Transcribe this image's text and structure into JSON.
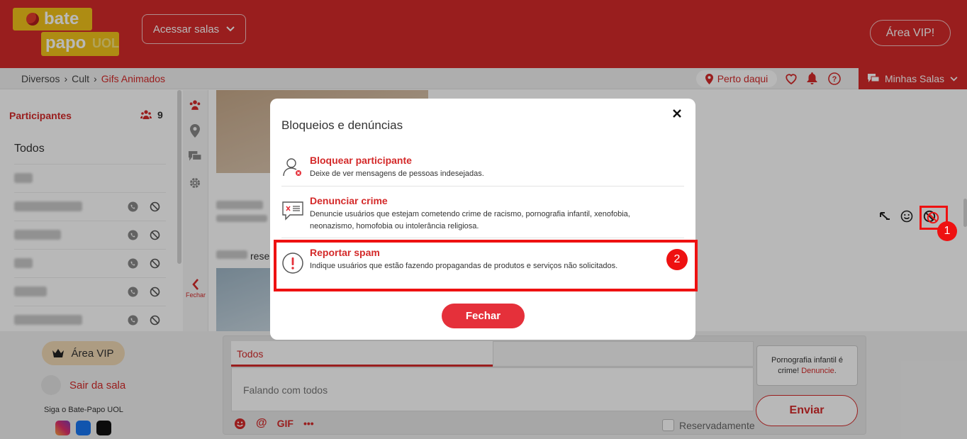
{
  "header": {
    "logo_line1": "bate",
    "logo_line2": "papo",
    "logo_brand": "UOL",
    "rooms_button": "Acessar salas",
    "vip_button": "Área VIP!"
  },
  "breadcrumb": {
    "items": [
      "Diversos",
      "Cult",
      "Gifs Animados"
    ],
    "separator": "›"
  },
  "topbar": {
    "nearby": "Perto daqui",
    "my_rooms": "Minhas Salas"
  },
  "sidebar": {
    "title": "Participantes",
    "count": "9",
    "all_label": "Todos",
    "close_label": "Fechar"
  },
  "bottom": {
    "vip_label": "Área VIP",
    "leave_label": "Sair da sala",
    "follow_label": "Siga o Bate-Papo UOL",
    "tab_all": "Todos",
    "input_placeholder": "Falando com todos",
    "gif_label": "GIF",
    "more_label": "•••",
    "reserved_label": "Reservadamente",
    "notice_text": "Pornografia infantil é crime!",
    "notice_link": "Denuncie",
    "notice_end": ".",
    "send_label": "Enviar"
  },
  "chat": {
    "partial_word": "rese"
  },
  "modal": {
    "title": "Bloqueios e denúncias",
    "options": [
      {
        "title": "Bloquear participante",
        "desc": "Deixe de ver mensagens de pessoas indesejadas."
      },
      {
        "title": "Denunciar crime",
        "desc": "Denuncie usuários que estejam cometendo crime de racismo, pornografia infantil, xenofobia, neonazismo, homofobia ou intolerância religiosa."
      },
      {
        "title": "Reportar spam",
        "desc": "Indique usuários que estão fazendo propagandas de produtos e serviços não solicitados."
      }
    ],
    "close_button": "Fechar"
  },
  "annotations": {
    "badge1": "1",
    "badge2": "2"
  },
  "colors": {
    "brand_red": "#d42a2a",
    "logo_yellow": "#f2c31b",
    "annotation_red": "#e11"
  }
}
